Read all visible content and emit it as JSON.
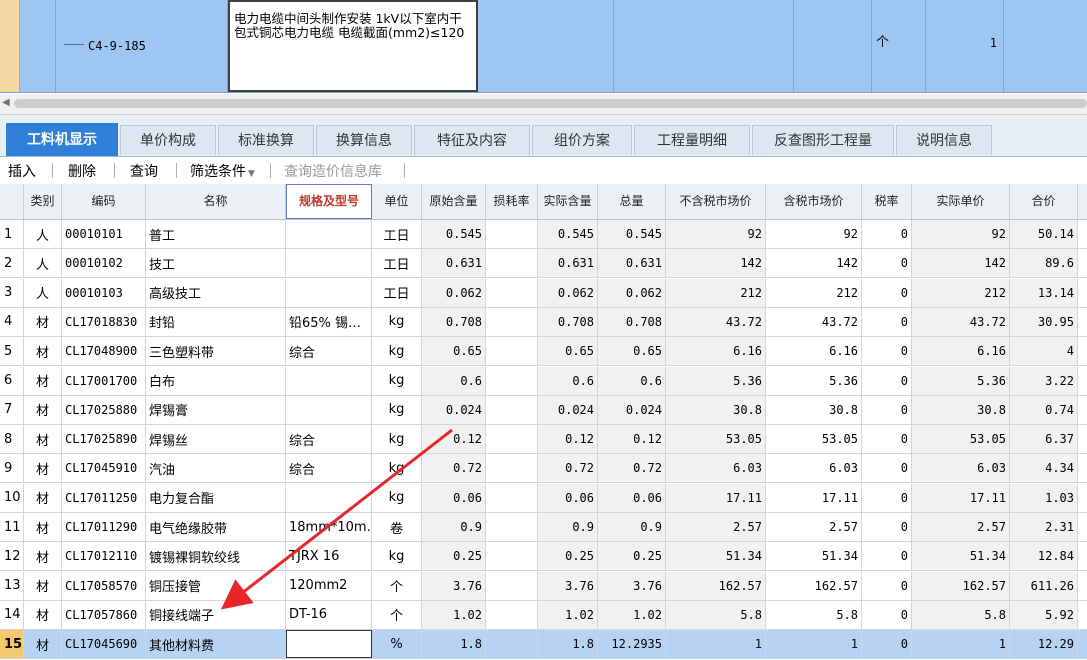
{
  "top_row": {
    "code": "C4-9-185",
    "name": "电力电缆中间头制作安装 1kV以下室内干包式铜芯电力电缆 电缆截面(mm2)≤120",
    "unit": "个",
    "qty": "1"
  },
  "tabs": [
    "工料机显示",
    "单价构成",
    "标准换算",
    "换算信息",
    "特征及内容",
    "组价方案",
    "工程量明细",
    "反查图形工程量",
    "说明信息"
  ],
  "toolbar": {
    "insert": "插入",
    "delete": "删除",
    "query": "查询",
    "filter": "筛选条件",
    "price_lib": "查询造价信息库"
  },
  "columns": [
    "类别",
    "编码",
    "名称",
    "规格及型号",
    "单位",
    "原始含量",
    "损耗率",
    "实际含量",
    "总量",
    "不含税市场价",
    "含税市场价",
    "税率",
    "实际单价",
    "合价"
  ],
  "rows": [
    {
      "no": "1",
      "type": "人",
      "code": "00010101",
      "name": "普工",
      "spec": "",
      "unit": "工日",
      "orig": "0.545",
      "loss": "",
      "actual": "0.545",
      "total": "0.545",
      "notax": "92",
      "tax": "92",
      "rate": "0",
      "price": "92",
      "sum": "50.14"
    },
    {
      "no": "2",
      "type": "人",
      "code": "00010102",
      "name": "技工",
      "spec": "",
      "unit": "工日",
      "orig": "0.631",
      "loss": "",
      "actual": "0.631",
      "total": "0.631",
      "notax": "142",
      "tax": "142",
      "rate": "0",
      "price": "142",
      "sum": "89.6"
    },
    {
      "no": "3",
      "type": "人",
      "code": "00010103",
      "name": "高级技工",
      "spec": "",
      "unit": "工日",
      "orig": "0.062",
      "loss": "",
      "actual": "0.062",
      "total": "0.062",
      "notax": "212",
      "tax": "212",
      "rate": "0",
      "price": "212",
      "sum": "13.14"
    },
    {
      "no": "4",
      "type": "材",
      "code": "CL17018830",
      "name": "封铅",
      "spec": "铅65% 锡…",
      "unit": "kg",
      "orig": "0.708",
      "loss": "",
      "actual": "0.708",
      "total": "0.708",
      "notax": "43.72",
      "tax": "43.72",
      "rate": "0",
      "price": "43.72",
      "sum": "30.95"
    },
    {
      "no": "5",
      "type": "材",
      "code": "CL17048900",
      "name": "三色塑料带",
      "spec": "综合",
      "unit": "kg",
      "orig": "0.65",
      "loss": "",
      "actual": "0.65",
      "total": "0.65",
      "notax": "6.16",
      "tax": "6.16",
      "rate": "0",
      "price": "6.16",
      "sum": "4"
    },
    {
      "no": "6",
      "type": "材",
      "code": "CL17001700",
      "name": "白布",
      "spec": "",
      "unit": "kg",
      "orig": "0.6",
      "loss": "",
      "actual": "0.6",
      "total": "0.6",
      "notax": "5.36",
      "tax": "5.36",
      "rate": "0",
      "price": "5.36",
      "sum": "3.22"
    },
    {
      "no": "7",
      "type": "材",
      "code": "CL17025880",
      "name": "焊锡膏",
      "spec": "",
      "unit": "kg",
      "orig": "0.024",
      "loss": "",
      "actual": "0.024",
      "total": "0.024",
      "notax": "30.8",
      "tax": "30.8",
      "rate": "0",
      "price": "30.8",
      "sum": "0.74"
    },
    {
      "no": "8",
      "type": "材",
      "code": "CL17025890",
      "name": "焊锡丝",
      "spec": "综合",
      "unit": "kg",
      "orig": "0.12",
      "loss": "",
      "actual": "0.12",
      "total": "0.12",
      "notax": "53.05",
      "tax": "53.05",
      "rate": "0",
      "price": "53.05",
      "sum": "6.37"
    },
    {
      "no": "9",
      "type": "材",
      "code": "CL17045910",
      "name": "汽油",
      "spec": "综合",
      "unit": "kg",
      "orig": "0.72",
      "loss": "",
      "actual": "0.72",
      "total": "0.72",
      "notax": "6.03",
      "tax": "6.03",
      "rate": "0",
      "price": "6.03",
      "sum": "4.34"
    },
    {
      "no": "10",
      "type": "材",
      "code": "CL17011250",
      "name": "电力复合酯",
      "spec": "",
      "unit": "kg",
      "orig": "0.06",
      "loss": "",
      "actual": "0.06",
      "total": "0.06",
      "notax": "17.11",
      "tax": "17.11",
      "rate": "0",
      "price": "17.11",
      "sum": "1.03"
    },
    {
      "no": "11",
      "type": "材",
      "code": "CL17011290",
      "name": "电气绝缘胶带",
      "spec": "18mm*10m…",
      "unit": "卷",
      "orig": "0.9",
      "loss": "",
      "actual": "0.9",
      "total": "0.9",
      "notax": "2.57",
      "tax": "2.57",
      "rate": "0",
      "price": "2.57",
      "sum": "2.31"
    },
    {
      "no": "12",
      "type": "材",
      "code": "CL17012110",
      "name": "镀锡裸铜软绞线",
      "spec": "TJRX 16",
      "unit": "kg",
      "orig": "0.25",
      "loss": "",
      "actual": "0.25",
      "total": "0.25",
      "notax": "51.34",
      "tax": "51.34",
      "rate": "0",
      "price": "51.34",
      "sum": "12.84"
    },
    {
      "no": "13",
      "type": "材",
      "code": "CL17058570",
      "name": "铜压接管",
      "spec": "120mm2",
      "unit": "个",
      "orig": "3.76",
      "loss": "",
      "actual": "3.76",
      "total": "3.76",
      "notax": "162.57",
      "tax": "162.57",
      "rate": "0",
      "price": "162.57",
      "sum": "611.26"
    },
    {
      "no": "14",
      "type": "材",
      "code": "CL17057860",
      "name": "铜接线端子",
      "spec": "DT-16",
      "unit": "个",
      "orig": "1.02",
      "loss": "",
      "actual": "1.02",
      "total": "1.02",
      "notax": "5.8",
      "tax": "5.8",
      "rate": "0",
      "price": "5.8",
      "sum": "5.92"
    },
    {
      "no": "15",
      "type": "材",
      "code": "CL17045690",
      "name": "其他材料费",
      "spec": "",
      "unit": "%",
      "orig": "1.8",
      "loss": "",
      "actual": "1.8",
      "total": "12.2935",
      "notax": "1",
      "tax": "1",
      "rate": "0",
      "price": "1",
      "sum": "12.29"
    }
  ],
  "annotation_color": "#e8262a"
}
